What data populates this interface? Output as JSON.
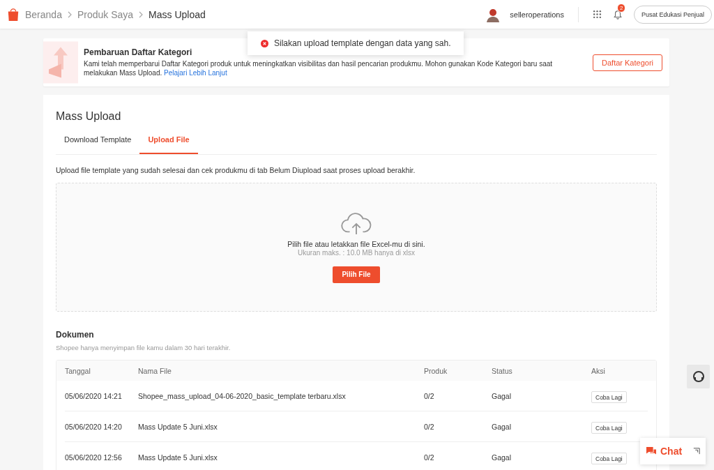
{
  "breadcrumb": [
    {
      "label": "Beranda"
    },
    {
      "label": "Produk Saya"
    },
    {
      "label": "Mass Upload"
    }
  ],
  "header": {
    "username": "selleroperations",
    "notification_count": "2",
    "education_button": "Pusat Edukasi Penjual"
  },
  "toast": {
    "message": "Silakan upload template dengan data yang sah."
  },
  "banner": {
    "title": "Pembaruan Daftar Kategori",
    "text": "Kami telah memperbarui Daftar Kategori produk untuk meningkatkan visibilitas dan hasil pencarian produkmu. Mohon gunakan Kode Kategori baru saat melakukan Mass Upload.",
    "link": "Pelajari Lebih Lanjut",
    "button": "Daftar Kategori"
  },
  "page_title": "Mass Upload",
  "tabs": [
    {
      "label": "Download Template",
      "selected": false
    },
    {
      "label": "Upload File",
      "selected": true
    }
  ],
  "instruction": "Upload file template yang sudah selesai dan cek produkmu di tab Belum Diupload saat proses upload berakhir.",
  "dropzone": {
    "text": "Pilih file atau letakkan file Excel-mu di sini.",
    "hint": "Ukuran maks. : 10.0 MB hanya di xlsx",
    "button": "Pilih File"
  },
  "documents": {
    "title": "Dokumen",
    "note": "Shopee hanya menyimpan file kamu dalam 30 hari terakhir.",
    "columns": [
      "Tanggal",
      "Nama File",
      "Produk",
      "Status",
      "Aksi"
    ],
    "rows": [
      {
        "date": "05/06/2020 14:21",
        "file": "Shopee_mass_upload_04-06-2020_basic_template terbaru.xlsx",
        "products": "0/2",
        "status": "Gagal",
        "action": "Coba Lagi"
      },
      {
        "date": "05/06/2020 14:20",
        "file": "Mass Update 5 Juni.xlsx",
        "products": "0/2",
        "status": "Gagal",
        "action": "Coba Lagi"
      },
      {
        "date": "05/06/2020 12:56",
        "file": "Mass Update 5 Juni.xlsx",
        "products": "0/2",
        "status": "Gagal",
        "action": "Coba Lagi"
      }
    ]
  },
  "chat": {
    "label": "Chat"
  }
}
